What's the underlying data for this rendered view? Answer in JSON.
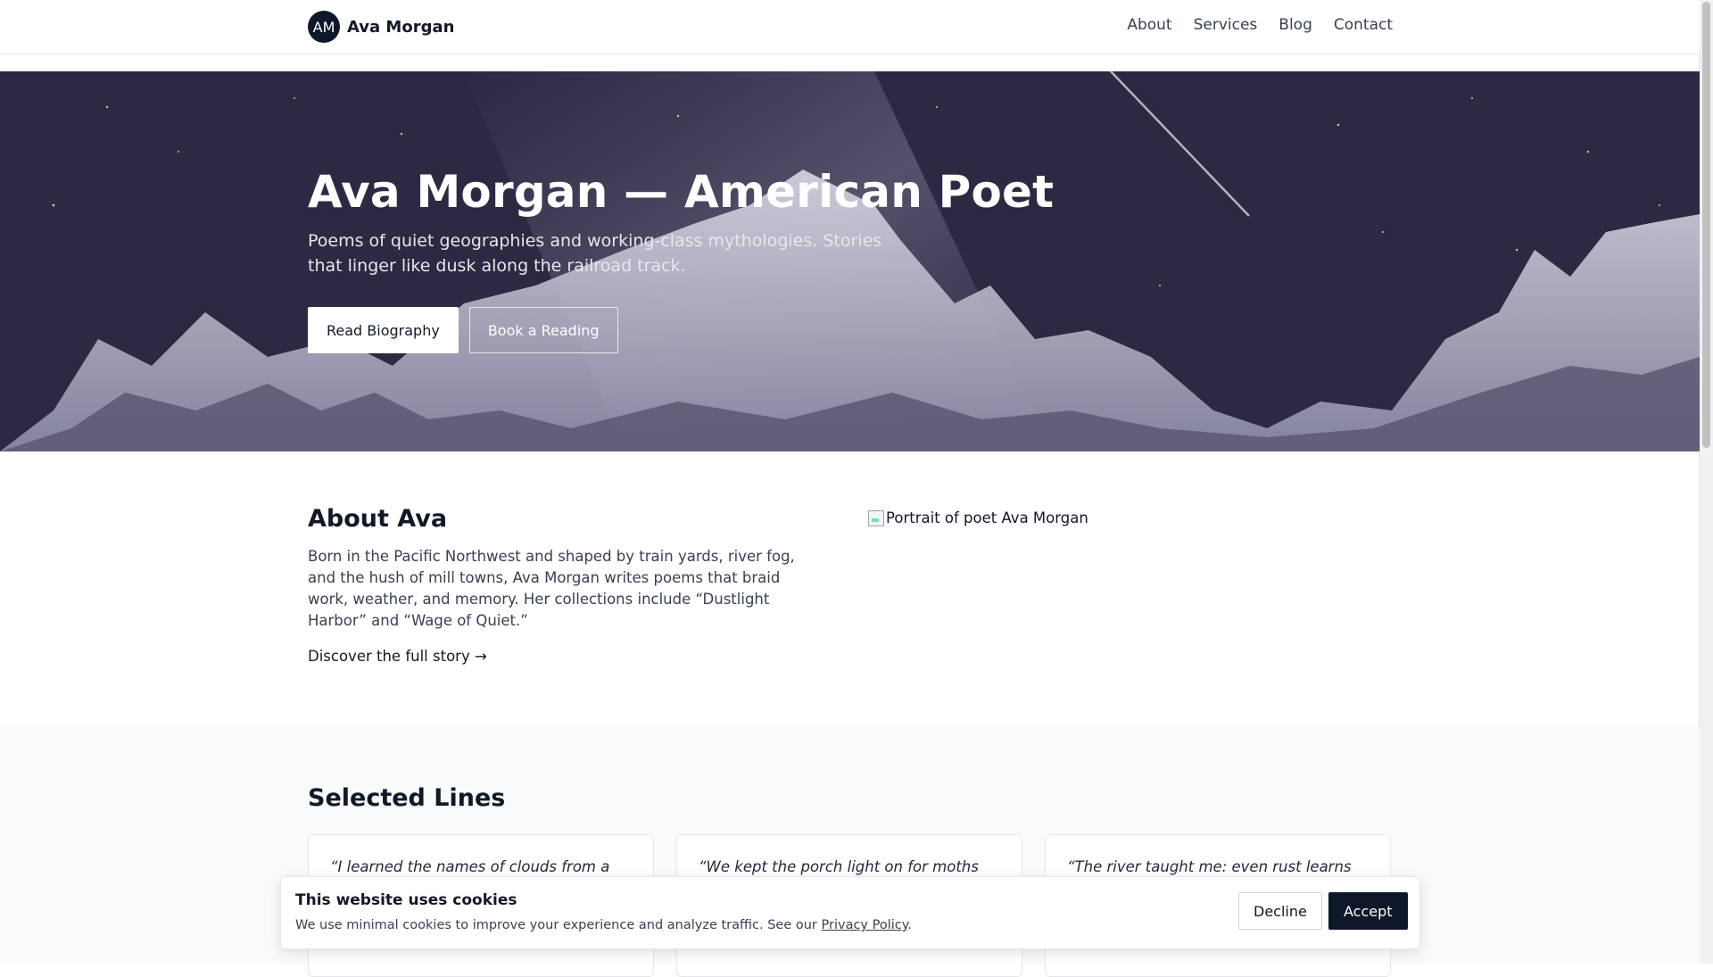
{
  "header": {
    "brand_initials": "AM",
    "brand_name": "Ava Morgan",
    "nav": [
      "About",
      "Services",
      "Blog",
      "Contact"
    ]
  },
  "hero": {
    "title": "Ava Morgan — American Poet",
    "subtitle": "Poems of quiet geographies and working-class mythologies. Stories that linger like dusk along the railroad track.",
    "primary_button": "Read Biography",
    "secondary_button": "Book a Reading"
  },
  "about": {
    "title": "About Ava",
    "body": "Born in the Pacific Northwest and shaped by train yards, river fog, and the hush of mill towns, Ava Morgan writes poems that braid work, weather, and memory. Her collections include “Dustlight Harbor” and “Wage of Quiet.”",
    "link": "Discover the full story →",
    "portrait_alt": "Portrait of poet Ava Morgan"
  },
  "selected_lines": {
    "title": "Selected Lines",
    "quotes": [
      "“I learned the names of clouds from a",
      "“We kept the porch light on for moths",
      "“The river taught me: even rust learns to"
    ]
  },
  "cookie_banner": {
    "title": "This website uses cookies",
    "text": "We use minimal cookies to improve your experience and analyze traffic. See our",
    "policy_link": "Privacy Policy",
    "decline": "Decline",
    "accept": "Accept"
  }
}
